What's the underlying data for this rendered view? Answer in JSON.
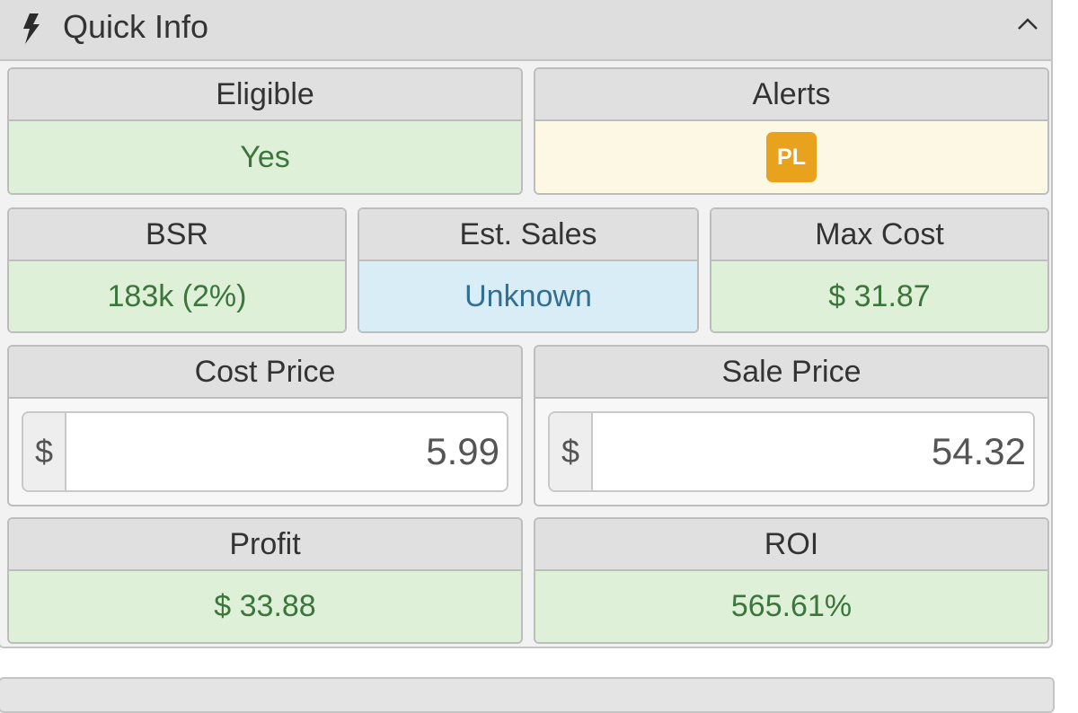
{
  "header": {
    "title": "Quick Info",
    "icon": "bolt-icon",
    "toggle_icon": "chevron-up-icon"
  },
  "cards": {
    "eligible": {
      "label": "Eligible",
      "value": "Yes"
    },
    "alerts": {
      "label": "Alerts",
      "badge": "PL",
      "badge_color": "#e9a21e"
    },
    "bsr": {
      "label": "BSR",
      "value": "183k (2%)"
    },
    "est_sales": {
      "label": "Est. Sales",
      "value": "Unknown"
    },
    "max_cost": {
      "label": "Max Cost",
      "value": "$ 31.87"
    },
    "cost_price": {
      "label": "Cost Price",
      "currency": "$",
      "value": "5.99"
    },
    "sale_price": {
      "label": "Sale Price",
      "currency": "$",
      "value": "54.32"
    },
    "profit": {
      "label": "Profit",
      "value": "$ 33.88"
    },
    "roi": {
      "label": "ROI",
      "value": "565.61%"
    }
  },
  "colors": {
    "success_bg": "#dff0d8",
    "success_text": "#3c763d",
    "info_bg": "#d9edf7",
    "info_text": "#31708f",
    "warning_bg": "#fcf8e3"
  }
}
